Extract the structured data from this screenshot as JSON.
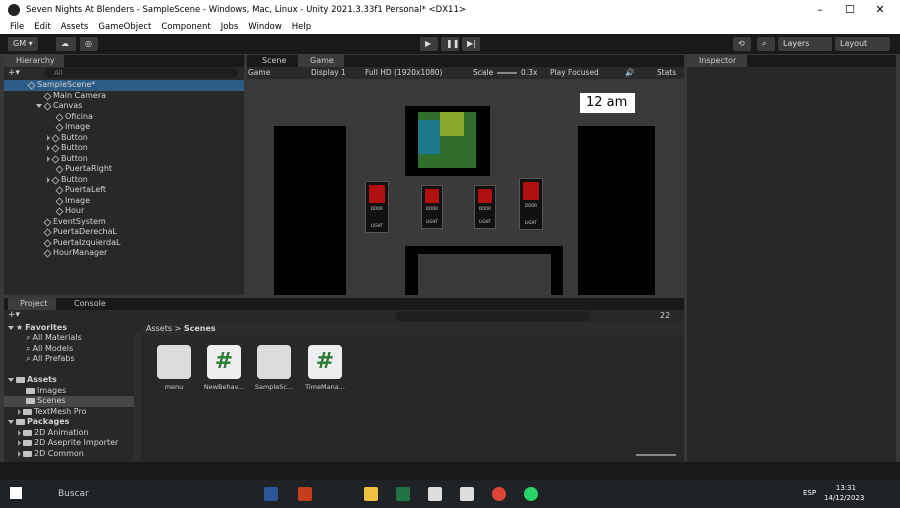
{
  "window": {
    "title": "Seven Nights At Blenders - SampleScene - Windows, Mac, Linux - Unity 2021.3.33f1 Personal* <DX11>",
    "min": "–",
    "max": "☐",
    "close": "✕"
  },
  "menu": [
    "File",
    "Edit",
    "Assets",
    "GameObject",
    "Component",
    "Jobs",
    "Window",
    "Help"
  ],
  "toolbar": {
    "account": "GM ▾",
    "layers": "Layers",
    "layout": "Layout"
  },
  "hierarchy": {
    "tab": "Hierarchy",
    "search_placeholder": "All",
    "scene": "SampleScene*",
    "items": [
      "Main Camera",
      "Canvas",
      "Oficina",
      "Image",
      "Button",
      "Button",
      "Button",
      "PuertaRight",
      "Button",
      "PuertaLeft",
      "Image",
      "Hour",
      "EventSystem",
      "PuertaDerechaL",
      "PuertaIzquierdaL",
      "HourManager"
    ]
  },
  "scene_tabs": {
    "scene": "Scene",
    "game": "Game"
  },
  "game_bar": {
    "mode": "Game",
    "display": "Display 1",
    "resolution": "Full HD (1920x1080)",
    "scale_label": "Scale",
    "scale_value": "0.3x",
    "play": "Play Focused",
    "stats": "Stats"
  },
  "game_view": {
    "clock": "12 am",
    "door_top": "DOOR",
    "light": "LIGHT"
  },
  "inspector": {
    "tab": "Inspector"
  },
  "project": {
    "tab": "Project",
    "console": "Console",
    "count": "22",
    "favorites": "Favorites",
    "fav_items": [
      "All Materials",
      "All Models",
      "All Prefabs"
    ],
    "assets": "Assets",
    "asset_items": [
      "Images",
      "Scenes",
      "TextMesh Pro"
    ],
    "packages": "Packages",
    "pkg_items": [
      "2D Animation",
      "2D Aseprite Importer",
      "2D Common"
    ],
    "breadcrumb_root": "Assets",
    "breadcrumb_current": "Scenes",
    "files": [
      {
        "name": "menu",
        "kind": "unity"
      },
      {
        "name": "NewBehav...",
        "kind": "script"
      },
      {
        "name": "SampleSc...",
        "kind": "unity"
      },
      {
        "name": "TimeMana...",
        "kind": "script"
      }
    ]
  },
  "taskbar": {
    "search": "Buscar",
    "lang": "ESP",
    "time": "13:31",
    "date": "14/12/2023"
  }
}
